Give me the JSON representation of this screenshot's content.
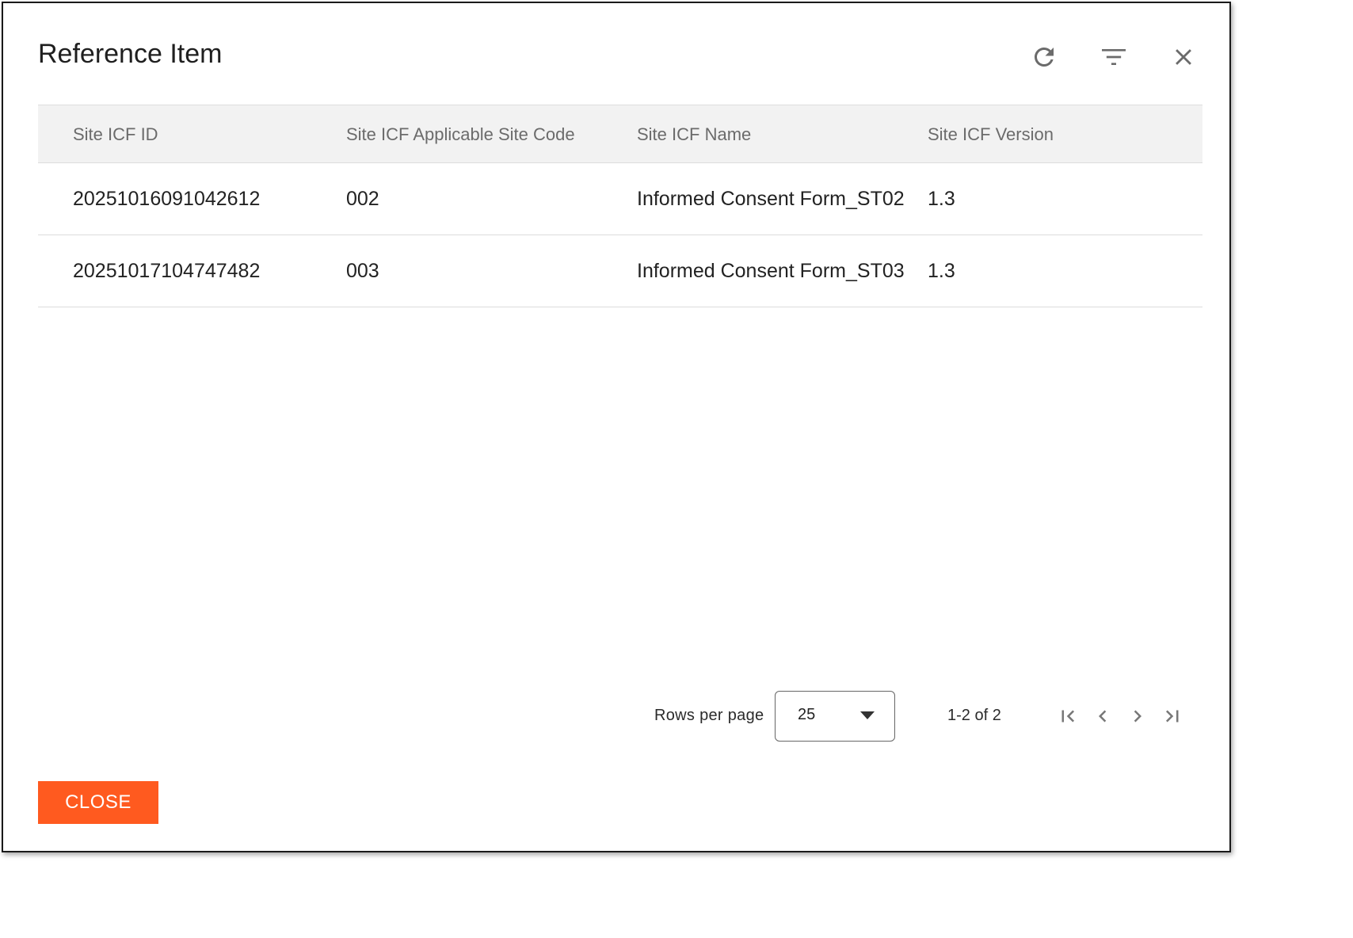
{
  "dialog": {
    "title": "Reference Item"
  },
  "table": {
    "columns": [
      "Site ICF ID",
      "Site ICF Applicable Site Code",
      "Site ICF Name",
      "Site ICF Version"
    ],
    "rows": [
      [
        "20251016091042612",
        "002",
        "Informed Consent Form_ST02",
        "1.3"
      ],
      [
        "20251017104747482",
        "003",
        "Informed Consent Form_ST03",
        "1.3"
      ]
    ]
  },
  "pagination": {
    "rows_per_page_label": "Rows per page",
    "rows_per_page_value": "25",
    "range_text": "1-2 of 2"
  },
  "footer": {
    "close_label": "CLOSE"
  },
  "colors": {
    "accent": "#ff5a1f",
    "header_bg": "#f2f2f2",
    "border": "#1a1a1a"
  }
}
